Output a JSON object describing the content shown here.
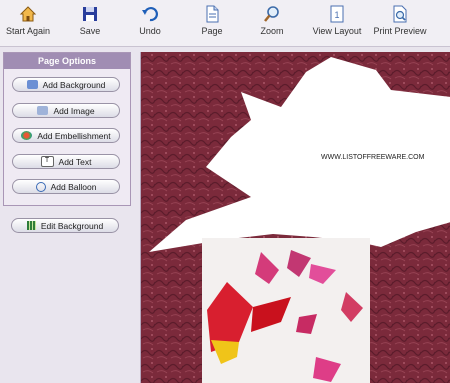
{
  "toolbar": {
    "start_again": "Start Again",
    "save": "Save",
    "undo": "Undo",
    "page": "Page",
    "zoom": "Zoom",
    "view_layout": "View Layout",
    "print_preview": "Print Preview"
  },
  "panel": {
    "title": "Page Options",
    "add_background": "Add Background",
    "add_image": "Add Image",
    "add_embellishment": "Add Embellishment",
    "add_text": "Add Text",
    "add_balloon": "Add Balloon"
  },
  "edit_background": "Edit Background",
  "canvas": {
    "balloon_text": "WWW.LISTOFFREEWARE.COM"
  },
  "colors": {
    "panel_header": "#a08db3",
    "canvas_bg": "#7b2a3b"
  }
}
